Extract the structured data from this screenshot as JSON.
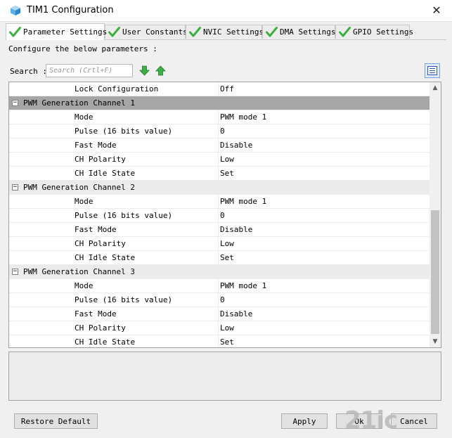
{
  "window": {
    "title": "TIM1 Configuration",
    "close_glyph": "✕"
  },
  "tabs": [
    {
      "label": "Parameter Settings",
      "icon": "check-icon",
      "active": true
    },
    {
      "label": "User Constants",
      "icon": "check-icon",
      "active": false
    },
    {
      "label": "NVIC Settings",
      "icon": "check-icon",
      "active": false
    },
    {
      "label": "DMA Settings",
      "icon": "check-icon",
      "active": false
    },
    {
      "label": "GPIO Settings",
      "icon": "check-icon",
      "active": false
    }
  ],
  "configure_text": "Configure the below parameters :",
  "search": {
    "label": "Search :",
    "placeholder": "Search (Crtl+F)",
    "value": ""
  },
  "grid": {
    "top_row": {
      "name": "Lock Configuration",
      "value": "Off"
    },
    "groups": [
      {
        "name": "PWM Generation Channel 1",
        "selected": true,
        "toggle": "−",
        "rows": [
          {
            "name": "Mode",
            "value": "PWM mode 1"
          },
          {
            "name": "Pulse (16 bits value)",
            "value": "0"
          },
          {
            "name": "Fast Mode",
            "value": "Disable"
          },
          {
            "name": "CH Polarity",
            "value": "Low"
          },
          {
            "name": "CH Idle State",
            "value": "Set"
          }
        ]
      },
      {
        "name": "PWM Generation Channel 2",
        "selected": false,
        "toggle": "−",
        "rows": [
          {
            "name": "Mode",
            "value": "PWM mode 1"
          },
          {
            "name": "Pulse (16 bits value)",
            "value": "0"
          },
          {
            "name": "Fast Mode",
            "value": "Disable"
          },
          {
            "name": "CH Polarity",
            "value": "Low"
          },
          {
            "name": "CH Idle State",
            "value": "Set"
          }
        ]
      },
      {
        "name": "PWM Generation Channel 3",
        "selected": false,
        "toggle": "−",
        "rows": [
          {
            "name": "Mode",
            "value": "PWM mode 1"
          },
          {
            "name": "Pulse (16 bits value)",
            "value": "0"
          },
          {
            "name": "Fast Mode",
            "value": "Disable"
          },
          {
            "name": "CH Polarity",
            "value": "Low"
          },
          {
            "name": "CH Idle State",
            "value": "Set"
          }
        ]
      }
    ]
  },
  "buttons": {
    "restore": "Restore Default",
    "apply": "Apply",
    "ok": "Ok",
    "cancel": "Cancel"
  },
  "watermark": "21ic",
  "colors": {
    "check_green": "#3cb043",
    "selected_group": "#a6a6a6",
    "group_bg": "#ebebeb"
  }
}
